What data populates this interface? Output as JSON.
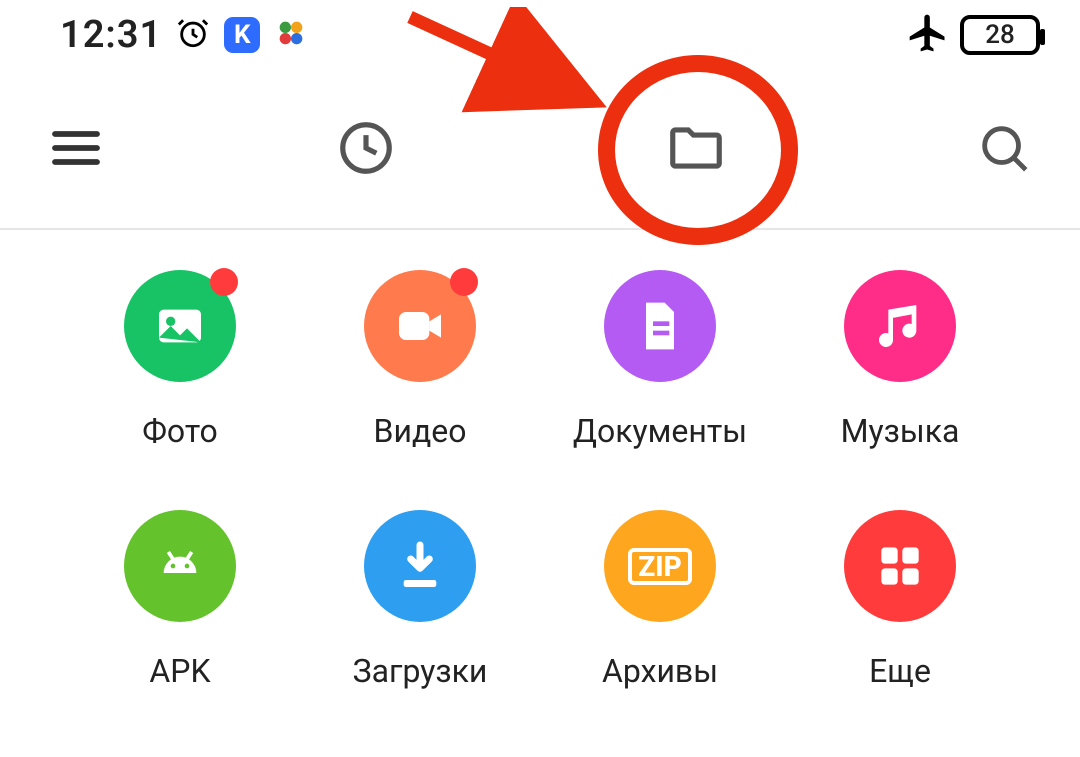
{
  "status": {
    "time": "12:31",
    "battery_percent": "28",
    "app_badge_letter": "K"
  },
  "categories": [
    {
      "label": "Фото"
    },
    {
      "label": "Видео"
    },
    {
      "label": "Документы"
    },
    {
      "label": "Музыка"
    },
    {
      "label": "APK"
    },
    {
      "label": "Загрузки"
    },
    {
      "label": "Архивы"
    },
    {
      "label": "Еще"
    }
  ],
  "archive_badge": "ZIP"
}
